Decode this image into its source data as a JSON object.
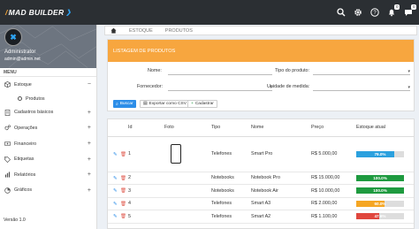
{
  "brand": {
    "name": "MAD BUILDER"
  },
  "topbar": {
    "badge_notifications": "0",
    "badge_messages": "0"
  },
  "profile": {
    "name": "Administrator",
    "email": "admin@admin.net"
  },
  "menu": {
    "header": "MENU",
    "items": [
      {
        "label": "Estoque",
        "icon": "cube-icon",
        "toggle": "−"
      },
      {
        "label": "Cadastros básicos",
        "icon": "document-icon",
        "toggle": "+"
      },
      {
        "label": "Operações",
        "icon": "cogs-icon",
        "toggle": "+"
      },
      {
        "label": "Financeiro",
        "icon": "money-icon",
        "toggle": "+"
      },
      {
        "label": "Etiquetas",
        "icon": "tag-icon",
        "toggle": "+"
      },
      {
        "label": "Relatórios",
        "icon": "chart-icon",
        "toggle": "+"
      },
      {
        "label": "Gráficos",
        "icon": "pie-icon",
        "toggle": "+"
      }
    ],
    "subitem": "Produtos",
    "version": "Versão 1.0"
  },
  "breadcrumb": {
    "items": [
      "ESTOQUE",
      "PRODUTOS"
    ]
  },
  "filter": {
    "title": "LISTAGEM DE PRODUTOS",
    "labels": {
      "nome": "Nome:",
      "tipo": "Tipo do produto:",
      "fornecedor": "Fornecedor:",
      "unidade": "Unidade de medida:"
    },
    "buttons": {
      "search": "Buscar",
      "export": "Exportar como CSV",
      "create": "Cadastrar"
    }
  },
  "table": {
    "headers": [
      "",
      "Id",
      "Foto",
      "Tipo",
      "Nome",
      "Preço",
      "Estoque atual"
    ],
    "rows": [
      {
        "id": "1",
        "tipo": "Telefones",
        "nome": "Smart Pro",
        "preco": "R$ 5.000,00",
        "estoque": "79.0%",
        "pct": 79,
        "color": "#2ba0de"
      },
      {
        "id": "2",
        "tipo": "Notebooks",
        "nome": "Notebook Pro",
        "preco": "R$ 15.000,00",
        "estoque": "100.0%",
        "pct": 100,
        "color": "#1e9a3f"
      },
      {
        "id": "3",
        "tipo": "Notebooks",
        "nome": "Notebook Air",
        "preco": "R$ 10.000,00",
        "estoque": "100.0%",
        "pct": 100,
        "color": "#1e9a3f"
      },
      {
        "id": "4",
        "tipo": "Telefones",
        "nome": "Smart A3",
        "preco": "R$ 2.000,00",
        "estoque": "60.0%",
        "pct": 60,
        "color": "#f5a623"
      },
      {
        "id": "5",
        "tipo": "Telefones",
        "nome": "Smart A2",
        "preco": "R$ 1.100,00",
        "estoque": "47.6%",
        "pct": 47.6,
        "color": "#e0473e"
      }
    ]
  }
}
